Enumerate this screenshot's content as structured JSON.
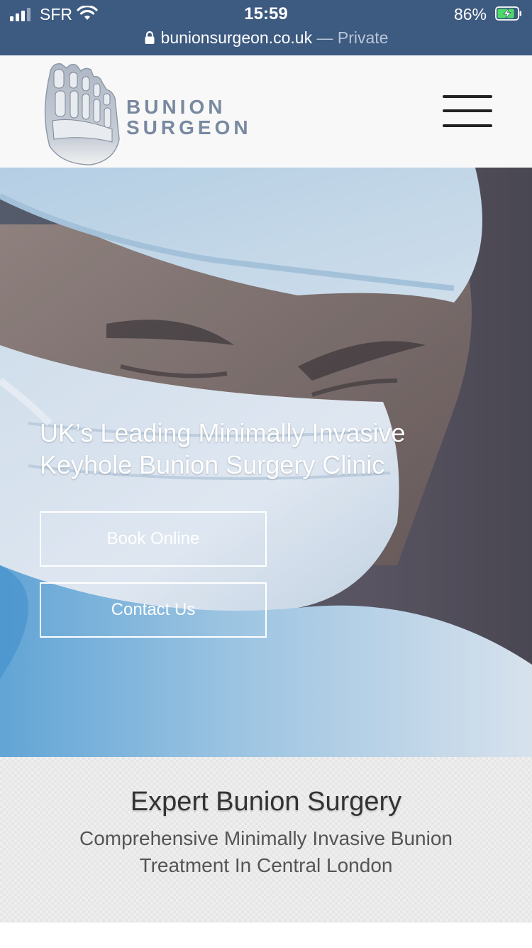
{
  "status_bar": {
    "carrier": "SFR",
    "time": "15:59",
    "battery": "86%",
    "battery_level": 0.86,
    "icons": [
      "signal-icon",
      "wifi-icon",
      "battery-charging-icon"
    ]
  },
  "url_bar": {
    "domain": "bunionsurgeon.co.uk",
    "separator": " — ",
    "mode": "Private",
    "icon": "lock-icon"
  },
  "header": {
    "logo_line1": "BUNION",
    "logo_line2": "SURGEON",
    "menu_icon": "hamburger-menu-icon"
  },
  "hero": {
    "title_line1": "UK’s Leading Minimally Invasive",
    "title_line2": "Keyhole Bunion Surgery Clinic",
    "book_button": "Book Online",
    "contact_button": "Contact Us"
  },
  "intro": {
    "title": "Expert Bunion Surgery",
    "subtitle": "Comprehensive Minimally Invasive Bunion Treatment In Central London"
  },
  "colors": {
    "browser_bar": "#3d5a80",
    "logo_text": "#7889a0",
    "header_bg": "#f8f8f8",
    "battery_fill": "#4cd964"
  }
}
